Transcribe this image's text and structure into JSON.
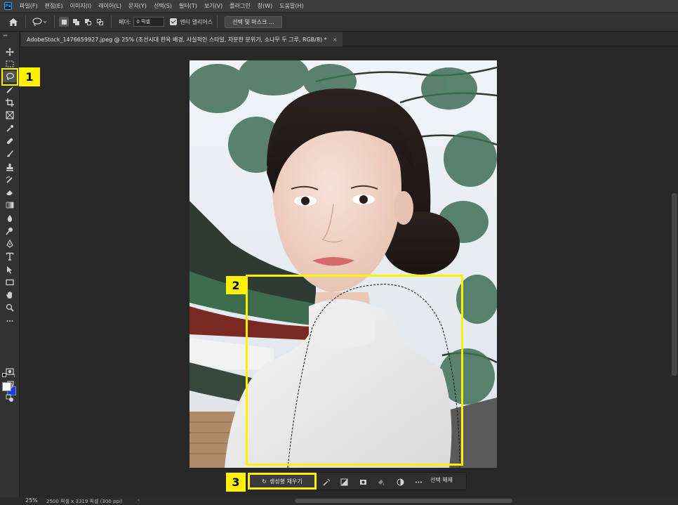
{
  "menubar": {
    "logo": "Ps",
    "items": [
      "파일(F)",
      "편집(E)",
      "이미지(I)",
      "레이어(L)",
      "문자(Y)",
      "선택(S)",
      "필터(T)",
      "보기(V)",
      "플러그인",
      "창(W)",
      "도움말(H)"
    ]
  },
  "options": {
    "feather_label": "페더:",
    "feather_value": "0 픽셀",
    "antialias_label": "앤티 앨리어스",
    "antialias_checked": true,
    "select_mask_label": "선택 및 마스크 ..."
  },
  "document": {
    "tab_title": "AdobeStock_1476659927.jpeg @ 25% (조선시대 한옥 배경, 사실적인 스타일, 차분한 분위기, 소나무 두 그루, RGB/8) *",
    "close_glyph": "×"
  },
  "toolbar": {
    "collapse_glyph": "▸▸",
    "active_tool": "lasso-tool",
    "foreground_color": "#ffffff",
    "background_color": "#1e3ae8"
  },
  "callouts": {
    "one": "1",
    "two": "2",
    "three": "3"
  },
  "taskbar": {
    "generative_fill_label": "생성형 채우기",
    "deselect_label": "선택 해제"
  },
  "status": {
    "zoom": "25%",
    "doc_info": "2500 픽셀 x 3319 픽셀 (300 ppi)",
    "arrow": "‹"
  },
  "colors": {
    "highlight": "#fff200",
    "ui_dark": "#282828",
    "panel": "#323232"
  }
}
